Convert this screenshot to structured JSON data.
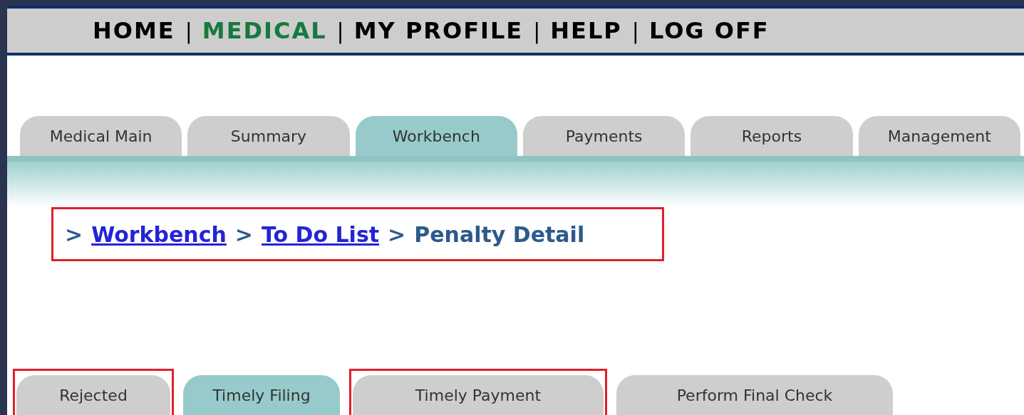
{
  "top_nav": {
    "separator": "|",
    "items": [
      {
        "label": "HOME",
        "selected": false
      },
      {
        "label": "MEDICAL",
        "selected": true
      },
      {
        "label": "MY PROFILE",
        "selected": false
      },
      {
        "label": "HELP",
        "selected": false
      },
      {
        "label": "LOG OFF",
        "selected": false
      }
    ]
  },
  "tabs": [
    {
      "label": "Medical Main",
      "selected": false
    },
    {
      "label": "Summary",
      "selected": false
    },
    {
      "label": "Workbench",
      "selected": true
    },
    {
      "label": "Payments",
      "selected": false
    },
    {
      "label": "Reports",
      "selected": false
    },
    {
      "label": "Management",
      "selected": false
    }
  ],
  "breadcrumb": {
    "highlighted": true,
    "items": [
      {
        "prefix": ">",
        "label": "Workbench",
        "link": true
      },
      {
        "prefix": ">",
        "label": "To Do List",
        "link": true
      },
      {
        "prefix": ">",
        "label": "Penalty Detail",
        "link": false
      }
    ]
  },
  "sub_tabs": [
    {
      "label": "Rejected",
      "selected": false,
      "highlighted": true
    },
    {
      "label": "Timely Filing",
      "selected": true,
      "highlighted": false
    },
    {
      "label": "Timely Payment",
      "selected": false,
      "highlighted": true
    },
    {
      "label": "Perform Final Check",
      "selected": false,
      "highlighted": false
    }
  ]
}
